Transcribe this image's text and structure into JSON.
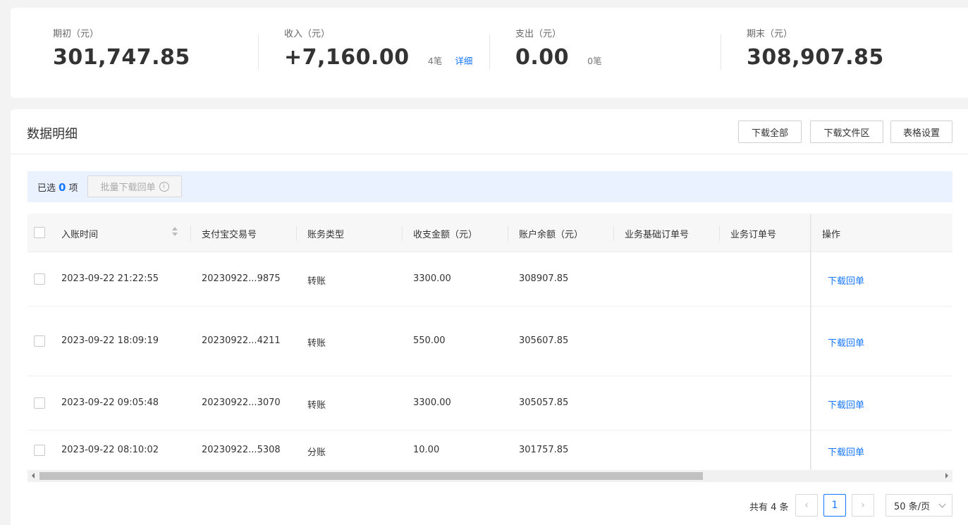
{
  "summary": {
    "opening": {
      "label": "期初（元）",
      "value": "301,747.85"
    },
    "income": {
      "label": "收入（元）",
      "value": "+7,160.00",
      "count": "4笔",
      "detail_link": "详细"
    },
    "expense": {
      "label": "支出（元）",
      "value": "0.00",
      "count": "0笔"
    },
    "closing": {
      "label": "期末（元）",
      "value": "308,907.85"
    }
  },
  "detail": {
    "title": "数据明细",
    "buttons": {
      "download_all": "下载全部",
      "download_files": "下载文件区",
      "table_settings": "表格设置"
    },
    "selection": {
      "prefix": "已选",
      "count": "0",
      "suffix": "项",
      "batch_download": "批量下载回单",
      "info_icon": "info-circle-icon"
    }
  },
  "table": {
    "columns": [
      "入账时间",
      "支付宝交易号",
      "账务类型",
      "收支金额（元）",
      "账户余额（元）",
      "业务基础订单号",
      "业务订单号",
      "操作"
    ],
    "rows": [
      {
        "time": "2023-09-22 21:22:55",
        "trade_no": "20230922...9875",
        "type": "转账",
        "amount": "3300.00",
        "balance": "308907.85",
        "base_order": "",
        "order": "",
        "action": "下载回单"
      },
      {
        "time": "2023-09-22 18:09:19",
        "trade_no": "20230922...4211",
        "type": "转账",
        "amount": "550.00",
        "balance": "305607.85",
        "base_order": "",
        "order": "",
        "action": "下载回单"
      },
      {
        "time": "2023-09-22 09:05:48",
        "trade_no": "20230922...3070",
        "type": "转账",
        "amount": "3300.00",
        "balance": "305057.85",
        "base_order": "",
        "order": "",
        "action": "下载回单"
      },
      {
        "time": "2023-09-22 08:10:02",
        "trade_no": "20230922...5308",
        "type": "分账",
        "amount": "10.00",
        "balance": "301757.85",
        "base_order": "",
        "order": "",
        "action": "下载回单"
      }
    ]
  },
  "pagination": {
    "total": "共有 4 条",
    "current_page": "1",
    "page_size": "50 条/页",
    "prev_icon": "chevron-left-icon",
    "next_icon": "chevron-right-icon"
  },
  "colors": {
    "accent": "#1677ff",
    "selection_bar": "#eaf2ff"
  }
}
